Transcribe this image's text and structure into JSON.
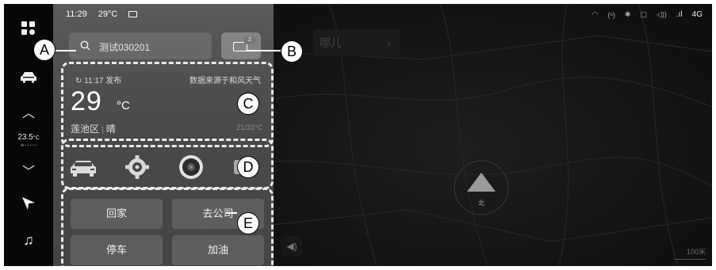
{
  "status_bar": {
    "time": "11:29",
    "temperature": "29°C",
    "mail_icon": "mail-icon",
    "network": "4G"
  },
  "search": {
    "text": "测试030201"
  },
  "messages": {
    "badge": "2"
  },
  "weather": {
    "publish": "11:17 发布",
    "source": "数据来源于和风天气",
    "temp": "29",
    "unit": "°C",
    "location": "莲池区",
    "condition": "晴",
    "range": "21/33°C"
  },
  "shortcuts": [
    "car-icon",
    "settings-gear-icon",
    "speaker-icon",
    "more-icon"
  ],
  "quick_actions": [
    "回家",
    "去公司",
    "停车",
    "加油"
  ],
  "sidebar": {
    "temp": "23.5",
    "temp_unit": "°C"
  },
  "map": {
    "tab_text": "哪儿",
    "scale": "100米",
    "compass": "北"
  },
  "callouts": [
    "A",
    "B",
    "C",
    "D",
    "E"
  ]
}
